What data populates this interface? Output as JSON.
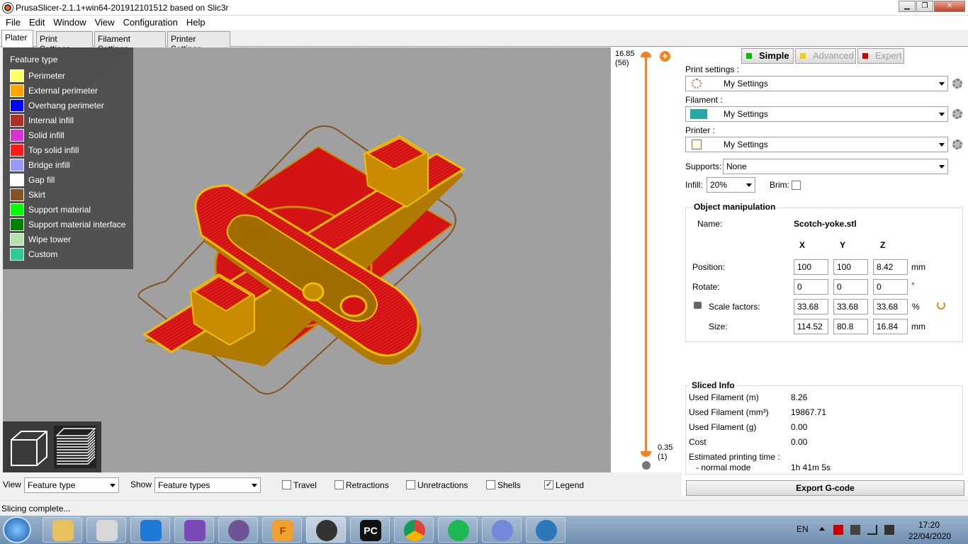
{
  "window": {
    "title": "PrusaSlicer-2.1.1+win64-201912101512 based on Slic3r",
    "minimize": "▁",
    "maximize": "❐",
    "close": "✕"
  },
  "menu": [
    "File",
    "Edit",
    "Window",
    "View",
    "Configuration",
    "Help"
  ],
  "tabs": [
    "Plater",
    "Print Settings",
    "Filament Settings",
    "Printer Settings"
  ],
  "legend": {
    "title": "Feature type",
    "items": [
      {
        "label": "Perimeter",
        "color": "#ffff66"
      },
      {
        "label": "External perimeter",
        "color": "#ffa500"
      },
      {
        "label": "Overhang perimeter",
        "color": "#0000ff"
      },
      {
        "label": "Internal infill",
        "color": "#b03029"
      },
      {
        "label": "Solid infill",
        "color": "#d732d7"
      },
      {
        "label": "Top solid infill",
        "color": "#ff1a1a"
      },
      {
        "label": "Bridge infill",
        "color": "#9999ff"
      },
      {
        "label": "Gap fill",
        "color": "#ffffff"
      },
      {
        "label": "Skirt",
        "color": "#845321"
      },
      {
        "label": "Support material",
        "color": "#00ff00"
      },
      {
        "label": "Support material interface",
        "color": "#008000"
      },
      {
        "label": "Wipe tower",
        "color": "#b3e3ab"
      },
      {
        "label": "Custom",
        "color": "#28cc94"
      }
    ]
  },
  "layer_slider": {
    "top_height": "16.85",
    "top_layer": "(56)",
    "bottom_height": "0.35",
    "bottom_layer": "(1)",
    "accent": "#f5821f"
  },
  "mode": {
    "simple": "Simple",
    "advanced": "Advanced",
    "expert": "Expert"
  },
  "settings": {
    "print_label": "Print settings :",
    "print_value": "My Settings",
    "filament_label": "Filament :",
    "filament_value": "My Settings",
    "filament_color": "#2aa6a6",
    "printer_label": "Printer :",
    "printer_value": "My Settings",
    "supports_label": "Supports:",
    "supports_value": "None",
    "infill_label": "Infill:",
    "infill_value": "20%",
    "brim_label": "Brim:"
  },
  "object": {
    "section_title": "Object manipulation",
    "name_label": "Name:",
    "name_value": "Scotch-yoke.stl",
    "axes": [
      "X",
      "Y",
      "Z"
    ],
    "position_label": "Position:",
    "position": [
      "100",
      "100",
      "8.42"
    ],
    "position_unit": "mm",
    "rotate_label": "Rotate:",
    "rotate": [
      "0",
      "0",
      "0"
    ],
    "rotate_unit": "°",
    "scale_label": "Scale factors:",
    "scale": [
      "33.68",
      "33.68",
      "33.68"
    ],
    "scale_unit": "%",
    "size_label": "Size:",
    "size": [
      "114.52",
      "80.8",
      "16.84"
    ],
    "size_unit": "mm"
  },
  "sliced": {
    "title": "Sliced Info",
    "rows": [
      {
        "label": "Used Filament (m)",
        "value": "8.26"
      },
      {
        "label": "Used Filament (mm³)",
        "value": "19867.71"
      },
      {
        "label": "Used Filament (g)",
        "value": "0.00"
      },
      {
        "label": "Cost",
        "value": "0.00"
      }
    ],
    "time_label": "Estimated printing time :",
    "mode_label": "- normal mode",
    "mode_value": "1h 41m 5s"
  },
  "export_label": "Export G-code",
  "bottom": {
    "view_label": "View",
    "view_value": "Feature type",
    "show_label": "Show",
    "show_value": "Feature types",
    "checks": [
      {
        "label": "Travel",
        "checked": false
      },
      {
        "label": "Retractions",
        "checked": false
      },
      {
        "label": "Unretractions",
        "checked": false
      },
      {
        "label": "Shells",
        "checked": false
      },
      {
        "label": "Legend",
        "checked": true
      }
    ]
  },
  "status": "Slicing complete...",
  "taskbar": {
    "apps": [
      "explorer",
      "calculator",
      "vscode",
      "visual-studio",
      "github-desktop",
      "fusion-360",
      "prusaslicer",
      "pycharm",
      "chrome",
      "spotify",
      "discord",
      "cura"
    ],
    "pycharm_text": "PC",
    "fusion_text": "F",
    "lang": "EN",
    "time": "17:20",
    "date": "22/04/2020"
  }
}
